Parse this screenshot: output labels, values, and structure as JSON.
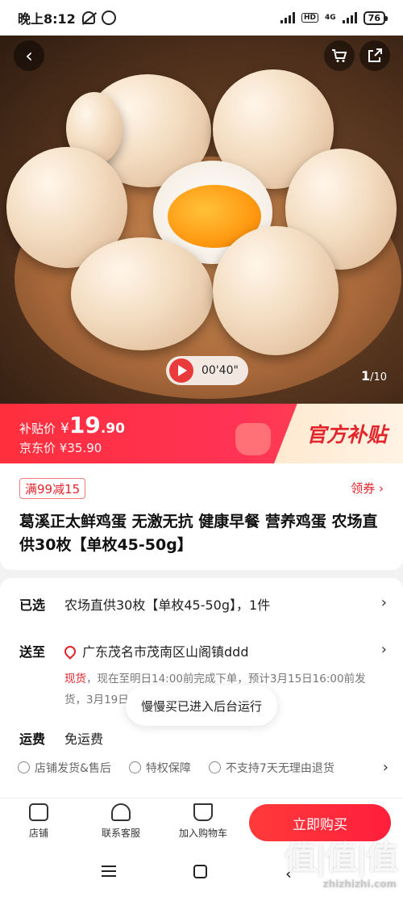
{
  "status_bar": {
    "time": "晚上8:12",
    "network": "4G",
    "hd": "HD",
    "battery": "76"
  },
  "hero": {
    "video_duration": "00'40\"",
    "pager_current": "1",
    "pager_total": "/10"
  },
  "price": {
    "subsidy_label": "补贴价",
    "currency": "¥",
    "subsidy_int": "19",
    "subsidy_dec": ".90",
    "jd_label": "京东价",
    "jd_price": "¥35.90",
    "official_badge": "官方补贴"
  },
  "product": {
    "coupon_tag": "满99减15",
    "get_coupon": "领券 ›",
    "title": "葛溪正太鲜鸡蛋 无激无抗 健康早餐 营养鸡蛋 农场直供30枚【单枚45-50g】"
  },
  "details": {
    "selected_label": "已选",
    "selected_value": "农场直供30枚【单枚45-50g】，1件",
    "ship_to_label": "送至",
    "address": "广东茂名市茂南区山阁镇ddd",
    "in_stock": "现货",
    "ship_note": "，现在至明日14:00前完成下单，预计3月15日16:00前发货，3月19日24:00",
    "freight_label": "运费",
    "freight_value": "免运费",
    "guarantees": [
      "店铺发货&售后",
      "特权保障",
      "不支持7天无理由退货"
    ]
  },
  "toast": "慢慢买已进入后台运行",
  "actions": {
    "store": "店铺",
    "service": "联系客服",
    "cart": "加入购物车",
    "buy": "立即购买"
  },
  "watermark": {
    "main": "值|值|值",
    "sub": "zhizhizhi.com"
  },
  "colors": {
    "accent": "#e4242b",
    "banner": "#ff2f3d"
  }
}
